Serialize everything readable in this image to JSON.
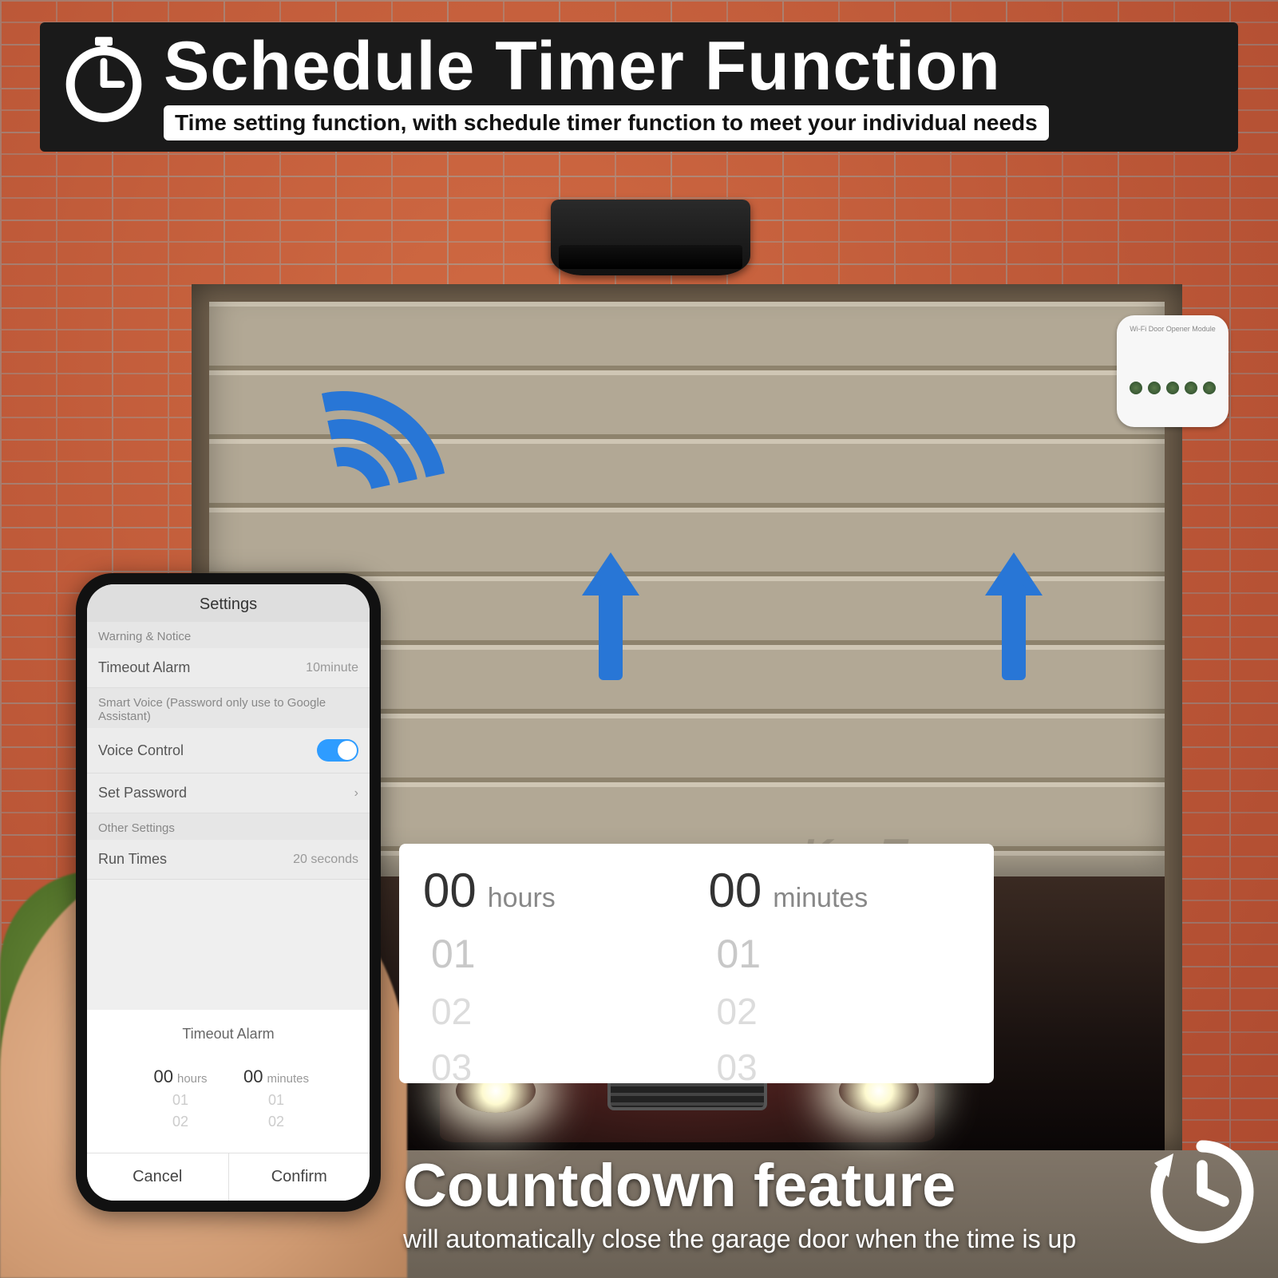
{
  "banner": {
    "title": "Schedule Timer Function",
    "subtitle": "Time setting function, with schedule timer function to meet your individual needs"
  },
  "phone": {
    "header": "Settings",
    "section_warning": "Warning & Notice",
    "timeout_alarm_label": "Timeout Alarm",
    "timeout_alarm_value": "10minute",
    "smart_voice_note": "Smart Voice (Password only use to Google Assistant)",
    "voice_control_label": "Voice Control",
    "set_password_label": "Set Password",
    "section_other": "Other Settings",
    "run_times_label": "Run Times",
    "run_times_value": "20 seconds",
    "modal_title": "Timeout Alarm",
    "picker": {
      "hours_main": "00",
      "hours_unit": "hours",
      "hours_next1": "01",
      "hours_next2": "02",
      "minutes_main": "00",
      "minutes_unit": "minutes",
      "minutes_next1": "01",
      "minutes_next2": "02"
    },
    "cancel": "Cancel",
    "confirm": "Confirm"
  },
  "zoom_picker": {
    "hours_main": "00",
    "hours_unit": "hours",
    "hours_next1": "01",
    "hours_next2": "02",
    "hours_next3": "03",
    "minutes_main": "00",
    "minutes_unit": "minutes",
    "minutes_next1": "01",
    "minutes_next2": "02",
    "minutes_next3": "03"
  },
  "countdown": {
    "title": "Countdown feature",
    "subtitle": "will automatically close the garage door when the time is up"
  },
  "watermark": "szKosTon",
  "device_label": "Wi-Fi Door Opener Module"
}
